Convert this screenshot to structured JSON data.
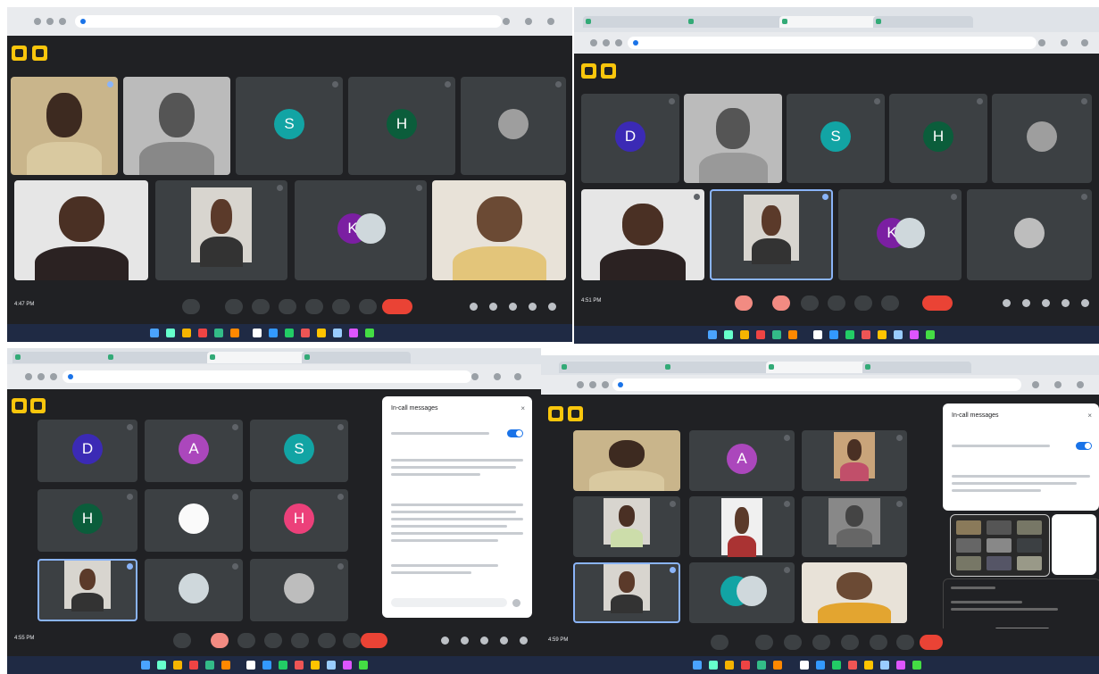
{
  "colors": {
    "meet_bg": "#202124",
    "tile_bg": "#3c4043",
    "end_call": "#ea4335",
    "logo": "#f9c60c",
    "taskbar": "#1f2a44",
    "accent": "#1a73e8"
  },
  "icons": [
    "meet-logo-icon",
    "mic-icon",
    "camera-icon",
    "present-icon",
    "raise-hand-icon",
    "more-icon",
    "end-call-icon",
    "info-icon",
    "people-icon",
    "chat-icon",
    "activities-icon",
    "lock-icon",
    "windows-start-icon"
  ],
  "quadrants": [
    {
      "time": "4:47 PM",
      "meeting": "meet.google.com",
      "names": [
        "",
        "",
        "S",
        "H",
        "",
        "",
        "",
        "K",
        ""
      ],
      "initials": [
        "",
        "",
        "S",
        "H",
        "",
        "",
        "",
        "K",
        ""
      ]
    },
    {
      "time": "4:51 PM",
      "meeting": "meet.google.com",
      "initials": [
        "D",
        "",
        "S",
        "H",
        "",
        "",
        "",
        "K",
        ""
      ]
    },
    {
      "time": "4:55 PM",
      "meeting": "meet.google.com",
      "initials": [
        "D",
        "A",
        "S",
        "H",
        "",
        "H",
        "",
        "",
        ""
      ]
    },
    {
      "time": "4:59 PM",
      "meeting": "meet.google.com",
      "initials": [
        "",
        "A",
        "",
        "",
        "",
        "",
        "",
        "",
        ""
      ]
    }
  ],
  "panels": {
    "p3_title": "In-call messages",
    "p4_title": "In-call messages"
  }
}
